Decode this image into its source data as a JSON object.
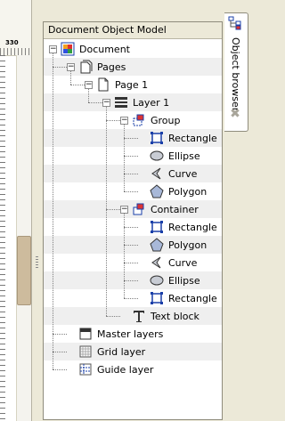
{
  "ruler": {
    "number": "330"
  },
  "panel": {
    "title": "Document Object Model"
  },
  "tab": {
    "label": "Object browser",
    "close_glyph": "✖"
  },
  "tree": [
    {
      "label": "Document",
      "icon": "document-color-icon",
      "expander": "−"
    },
    {
      "label": "Pages",
      "icon": "pages-icon",
      "expander": "−"
    },
    {
      "label": "Page 1",
      "icon": "page-icon",
      "expander": "−"
    },
    {
      "label": "Layer 1",
      "icon": "layer-icon",
      "expander": "−"
    },
    {
      "label": "Group",
      "icon": "group-icon",
      "expander": "−"
    },
    {
      "label": "Rectangle",
      "icon": "rectangle-icon"
    },
    {
      "label": "Ellipse",
      "icon": "ellipse-icon"
    },
    {
      "label": "Curve",
      "icon": "curve-icon"
    },
    {
      "label": "Polygon",
      "icon": "polygon-icon"
    },
    {
      "label": "Container",
      "icon": "container-icon",
      "expander": "−"
    },
    {
      "label": "Rectangle",
      "icon": "rectangle-icon"
    },
    {
      "label": "Polygon",
      "icon": "polygon-icon"
    },
    {
      "label": "Curve",
      "icon": "curve-icon"
    },
    {
      "label": "Ellipse",
      "icon": "ellipse-icon"
    },
    {
      "label": "Rectangle",
      "icon": "rectangle-icon"
    },
    {
      "label": "Text block",
      "icon": "text-icon"
    },
    {
      "label": "Master layers",
      "icon": "master-layers-icon"
    },
    {
      "label": "Grid layer",
      "icon": "grid-icon"
    },
    {
      "label": "Guide layer",
      "icon": "guide-icon"
    }
  ]
}
